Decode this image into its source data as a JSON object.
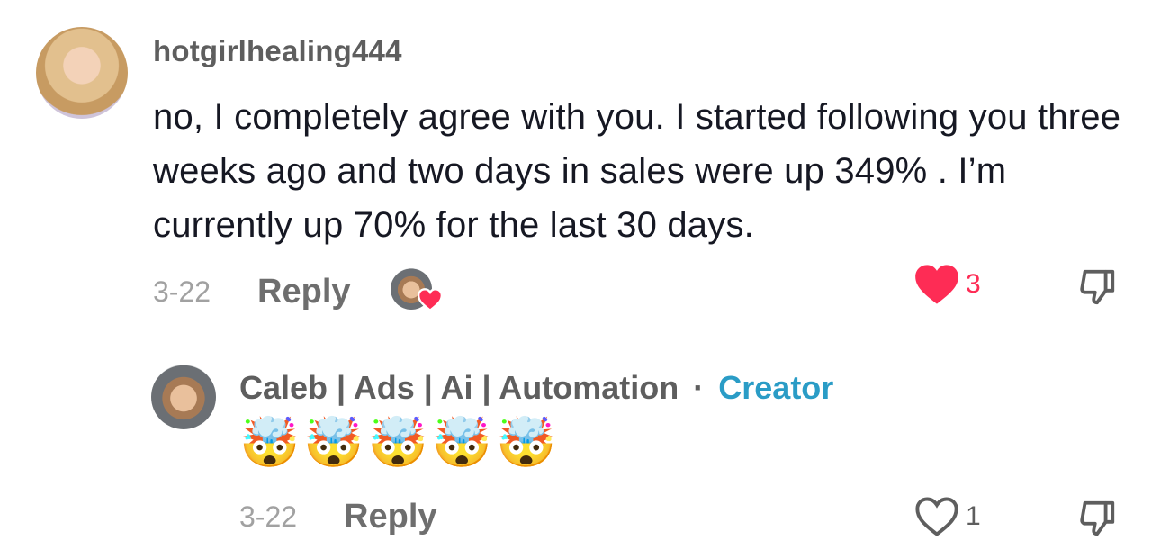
{
  "comment": {
    "username": "hotgirlhealing444",
    "text": "no, I completely agree with you. I started following you three weeks ago and two days in sales were up 349% . I’m currently up 70% for the last 30 days.",
    "date": "3-22",
    "reply_label": "Reply",
    "like_count": "3",
    "liked": true,
    "creator_liked": true
  },
  "reply": {
    "username": "Caleb | Ads | Ai | Automation",
    "separator": "·",
    "badge": "Creator",
    "text": "🤯🤯🤯🤯🤯",
    "date": "3-22",
    "reply_label": "Reply",
    "like_count": "1",
    "liked": false
  },
  "colors": {
    "like_red": "#fe2c55",
    "creator_blue": "#2a9cc6",
    "username_gray": "#5e5e5e",
    "meta_gray": "#a1a1a1",
    "text_dark": "#161823"
  },
  "icons": [
    "heart-filled-icon",
    "heart-outline-icon",
    "dislike-icon",
    "creator-liked-heart-icon"
  ]
}
